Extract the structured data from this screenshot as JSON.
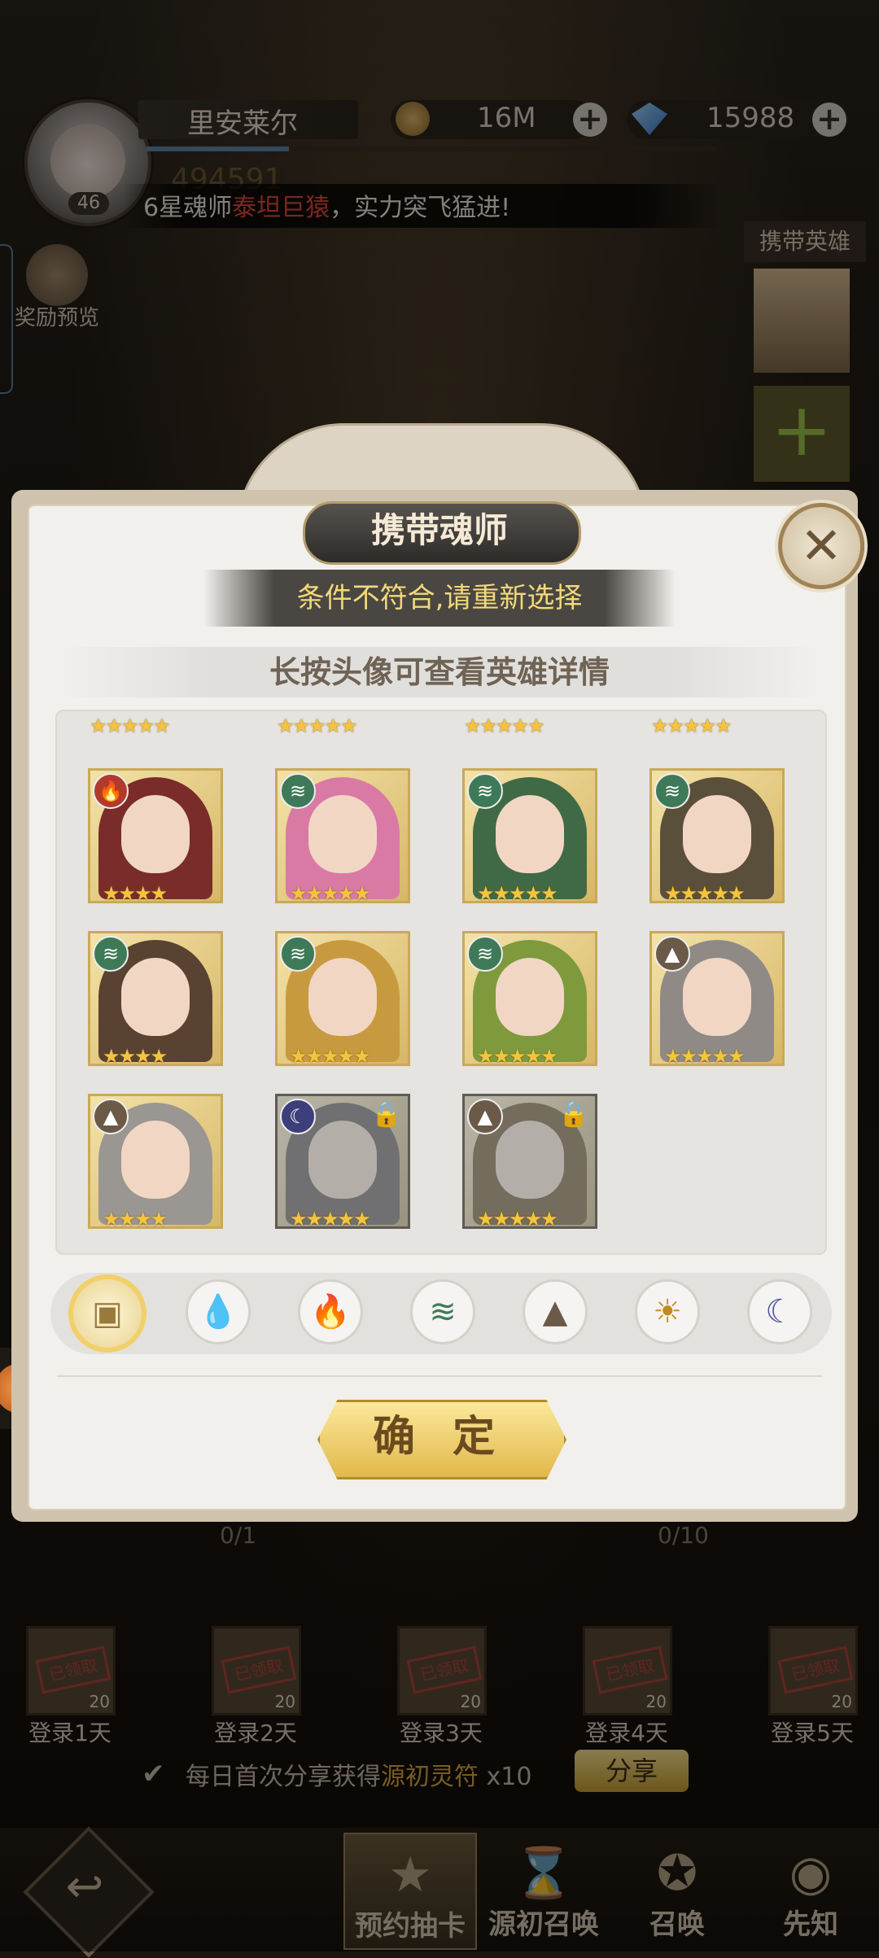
{
  "player": {
    "name": "里安莱尔",
    "level": "46",
    "gold": "16M",
    "gems": "15988",
    "power": "494591",
    "xp_fraction": 0.25
  },
  "marquee": {
    "prefix": "6星魂师",
    "hero": "泰坦巨猿",
    "suffix": "，实力突飞猛进!"
  },
  "side": {
    "reward_preview": "奖励预览",
    "carry_hero": "携带英雄"
  },
  "modal": {
    "title": "携带魂师",
    "warning": "条件不符合,请重新选择",
    "hint": "长按头像可查看英雄详情",
    "confirm": "确 定",
    "cards": [
      {
        "element": "fire",
        "stars": "★★★★",
        "locked": false,
        "color": "#7a2c2a"
      },
      {
        "element": "wind",
        "stars": "★★★★★",
        "locked": false,
        "color": "#d97aa5"
      },
      {
        "element": "wind",
        "stars": "★★★★★",
        "locked": false,
        "color": "#3f6a45"
      },
      {
        "element": "wind",
        "stars": "★★★★★",
        "locked": false,
        "color": "#5a4f3a"
      },
      {
        "element": "wind",
        "stars": "★★★★",
        "locked": false,
        "color": "#5a4232"
      },
      {
        "element": "wind",
        "stars": "★★★★★",
        "locked": false,
        "color": "#c89a3f"
      },
      {
        "element": "wind",
        "stars": "★★★★★",
        "locked": false,
        "color": "#7e9a3c"
      },
      {
        "element": "earth",
        "stars": "★★★★★",
        "locked": false,
        "color": "#8f8a86"
      },
      {
        "element": "earth",
        "stars": "★★★★",
        "locked": false,
        "color": "#9a9691"
      },
      {
        "element": "moon",
        "stars": "★★★★★",
        "locked": true,
        "color": "#8d8b93"
      },
      {
        "element": "earth",
        "stars": "★★★★★",
        "locked": true,
        "color": "#a98448"
      }
    ],
    "filters": [
      "all-filter",
      "water-filter",
      "fire-filter",
      "wind-filter",
      "earth-filter",
      "light-filter",
      "moon-filter"
    ]
  },
  "progress": {
    "left": "0/1",
    "right": "0/10"
  },
  "days": [
    {
      "label": "登录1天",
      "stamp": "已领取",
      "num": "20"
    },
    {
      "label": "登录2天",
      "stamp": "已领取",
      "num": "20"
    },
    {
      "label": "登录3天",
      "stamp": "已领取",
      "num": "20"
    },
    {
      "label": "登录4天",
      "stamp": "已领取",
      "num": "20"
    },
    {
      "label": "登录5天",
      "stamp": "已领取",
      "num": "20"
    }
  ],
  "share": {
    "text_a": "每日首次分享获得",
    "text_hl": "源初灵符",
    "text_b": " x10",
    "button": "分享"
  },
  "nav": {
    "tab1": "预约抽卡",
    "tab2": "源初召唤",
    "tab3": "召唤",
    "tab4": "先知"
  }
}
